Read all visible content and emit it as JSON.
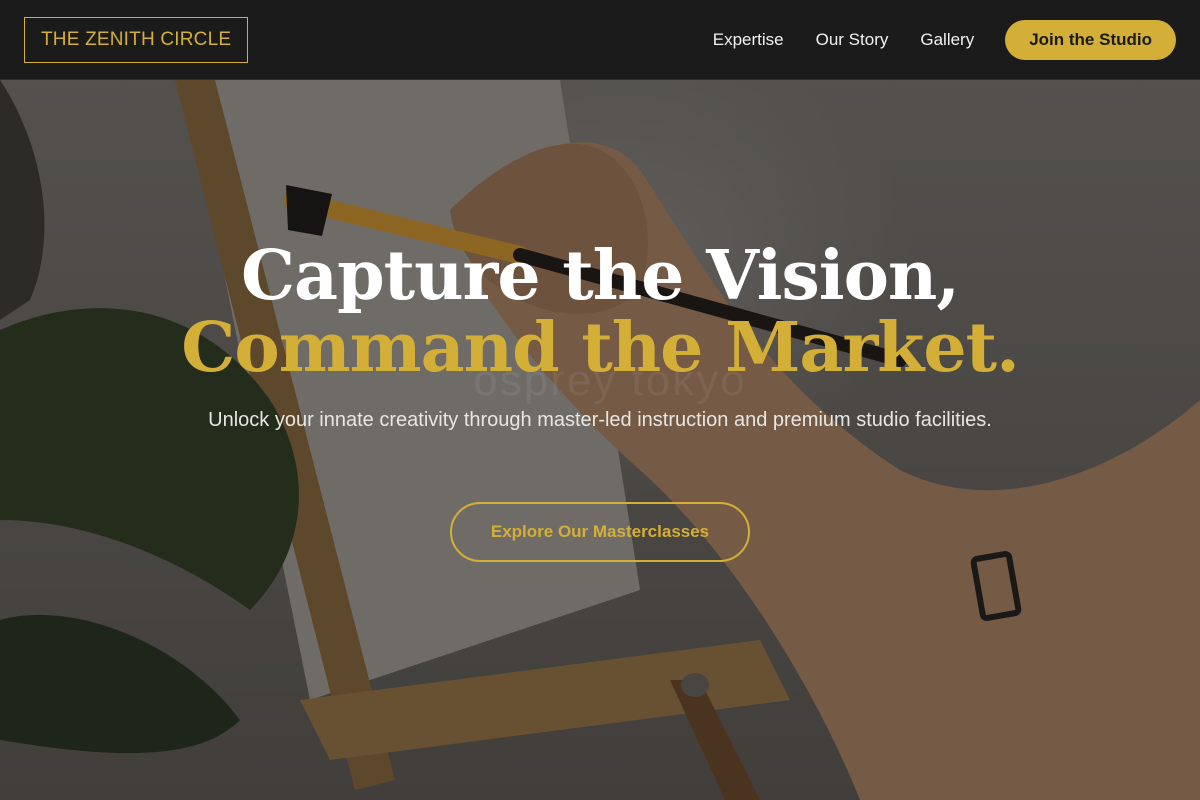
{
  "navbar": {
    "brand": "THE ZENITH CIRCLE",
    "links": [
      {
        "label": "Expertise"
      },
      {
        "label": "Our Story"
      },
      {
        "label": "Gallery"
      }
    ],
    "cta_label": "Join the Studio"
  },
  "hero": {
    "headline_line1": "Capture the Vision,",
    "headline_line2": "Command the Market.",
    "subheadline": "Unlock your innate creativity through master-led instruction and premium studio facilities.",
    "cta_label": "Explore Our Masterclasses",
    "background_watermark": "osprey tokyo"
  },
  "colors": {
    "accent_gold": "#d4af37",
    "nav_background": "#1b1b1b",
    "headline_white": "#ffffff"
  },
  "icons": {
    "background_image": "artist-painting-on-easel-image"
  }
}
